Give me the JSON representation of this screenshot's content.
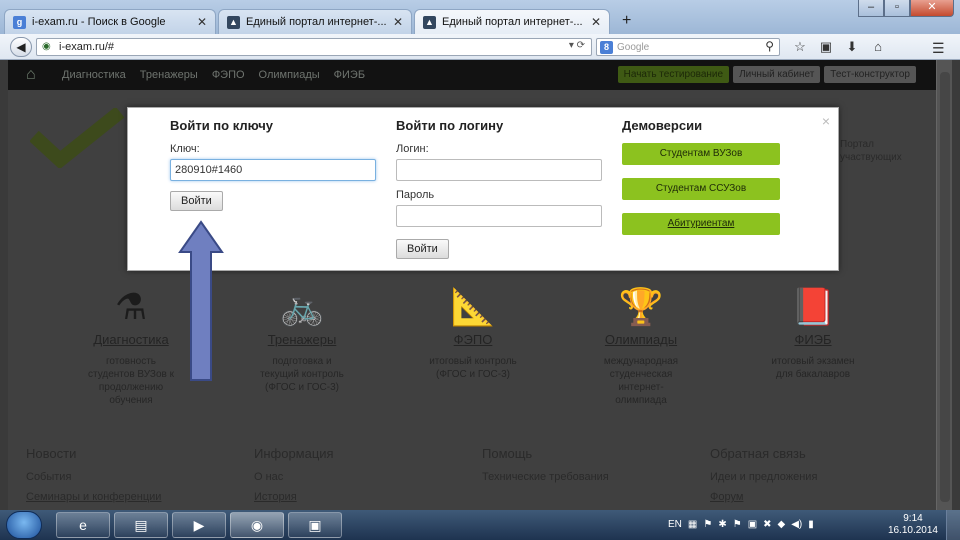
{
  "browser": {
    "tabs": [
      {
        "label": "i-exam.ru - Поиск в Google",
        "icon": "google-icon"
      },
      {
        "label": "Единый портал интернет-...",
        "icon": "graduation-cap-icon"
      },
      {
        "label": "Единый портал интернет-...",
        "icon": "graduation-cap-icon"
      }
    ],
    "new_tab": "+",
    "url": "i-exam.ru/#",
    "search_placeholder": "Google"
  },
  "site": {
    "nav": [
      "Диагностика",
      "Тренажеры",
      "ФЭПО",
      "Олимпиады",
      "ФИЭБ"
    ],
    "header_buttons": [
      "Начать тестирование",
      "Личный кабинет",
      "Тест-конструктор"
    ],
    "portal_text": [
      "Портал",
      "участвующих"
    ],
    "sections": [
      {
        "title": "Диагностика",
        "desc": [
          "готовность",
          "студентов ВУЗов к",
          "продолжению",
          "обучения"
        ],
        "icon": "microscope-icon"
      },
      {
        "title": "Тренажеры",
        "desc": [
          "подготовка и",
          "текущий контроль",
          "(ФГОС и ГОС-3)"
        ],
        "icon": "bicycle-book-icon"
      },
      {
        "title": "ФЭПО",
        "desc": [
          "итоговый контроль",
          "(ФГОС и ГОС-3)"
        ],
        "icon": "caliper-icon"
      },
      {
        "title": "Олимпиады",
        "desc": [
          "международная",
          "студенческая",
          "интернет-",
          "олимпиада"
        ],
        "icon": "cup-icon"
      },
      {
        "title": "ФИЭБ",
        "desc": [
          "итоговый экзамен",
          "для бакалавров"
        ],
        "icon": "book-icon"
      }
    ],
    "footer": [
      {
        "title": "Новости",
        "links": [
          "События",
          "Семинары и конференции"
        ]
      },
      {
        "title": "Информация",
        "links": [
          "О нас",
          "История"
        ]
      },
      {
        "title": "Помощь",
        "links": [
          "Технические требования"
        ]
      },
      {
        "title": "Обратная связь",
        "links": [
          "Идеи и предложения",
          "Форум"
        ]
      }
    ]
  },
  "modal": {
    "key_login": {
      "title": "Войти по ключу",
      "key_label": "Ключ:",
      "key_value": "280910#1460",
      "submit": "Войти"
    },
    "password_login": {
      "title": "Войти по логину",
      "login_label": "Логин:",
      "password_label": "Пароль",
      "submit": "Войти"
    },
    "demo": {
      "title": "Демоверсии",
      "buttons": [
        "Студентам ВУЗов",
        "Студентам ССУЗов",
        "Абитуриентам"
      ]
    },
    "close": "×",
    "accent_color": "#8cc21f"
  },
  "taskbar": {
    "lang": "EN",
    "time": "9:14",
    "date": "16.10.2014"
  }
}
